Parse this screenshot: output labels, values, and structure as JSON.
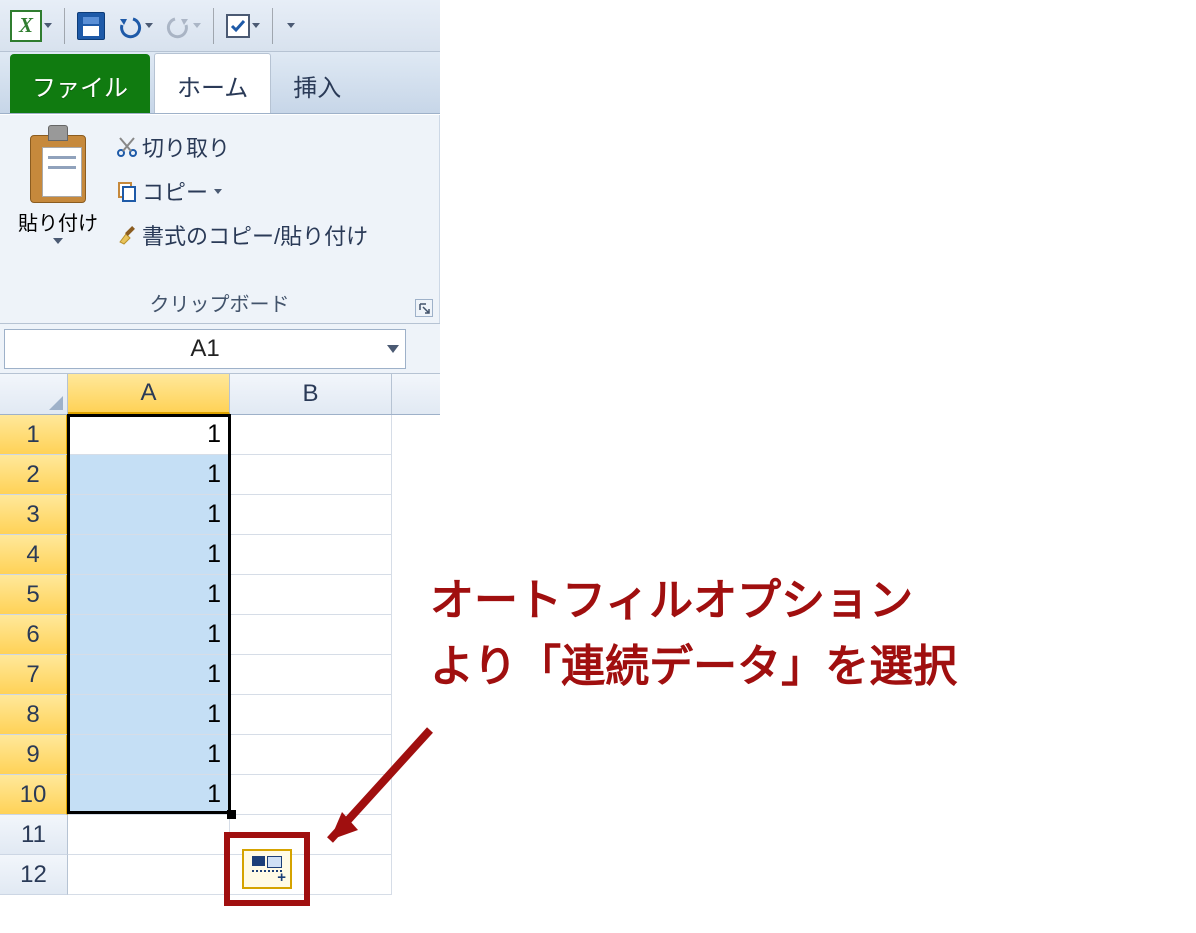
{
  "qat": {
    "excel_letter": "X"
  },
  "tabs": {
    "file": "ファイル",
    "home": "ホーム",
    "insert": "挿入"
  },
  "clipboard_group": {
    "paste": "貼り付け",
    "cut": "切り取り",
    "copy": "コピー",
    "format_painter": "書式のコピー/貼り付け",
    "title": "クリップボード"
  },
  "name_box": {
    "value": "A1"
  },
  "columns": [
    "A",
    "B"
  ],
  "rows": [
    "1",
    "2",
    "3",
    "4",
    "5",
    "6",
    "7",
    "8",
    "9",
    "10",
    "11",
    "12"
  ],
  "cell_values": {
    "A": [
      "1",
      "1",
      "1",
      "1",
      "1",
      "1",
      "1",
      "1",
      "1",
      "1",
      "",
      ""
    ],
    "B": [
      "",
      "",
      "",
      "",
      "",
      "",
      "",
      "",
      "",
      "",
      "",
      ""
    ]
  },
  "selection": {
    "range": "A1:A10",
    "active": "A1"
  },
  "annotation": {
    "line1": "オートフィルオプション",
    "line2": "より「連続データ」を選択"
  },
  "colors": {
    "annotation": "#a00f0f",
    "excel_green": "#107b10",
    "selected_header": "#ffd257"
  }
}
